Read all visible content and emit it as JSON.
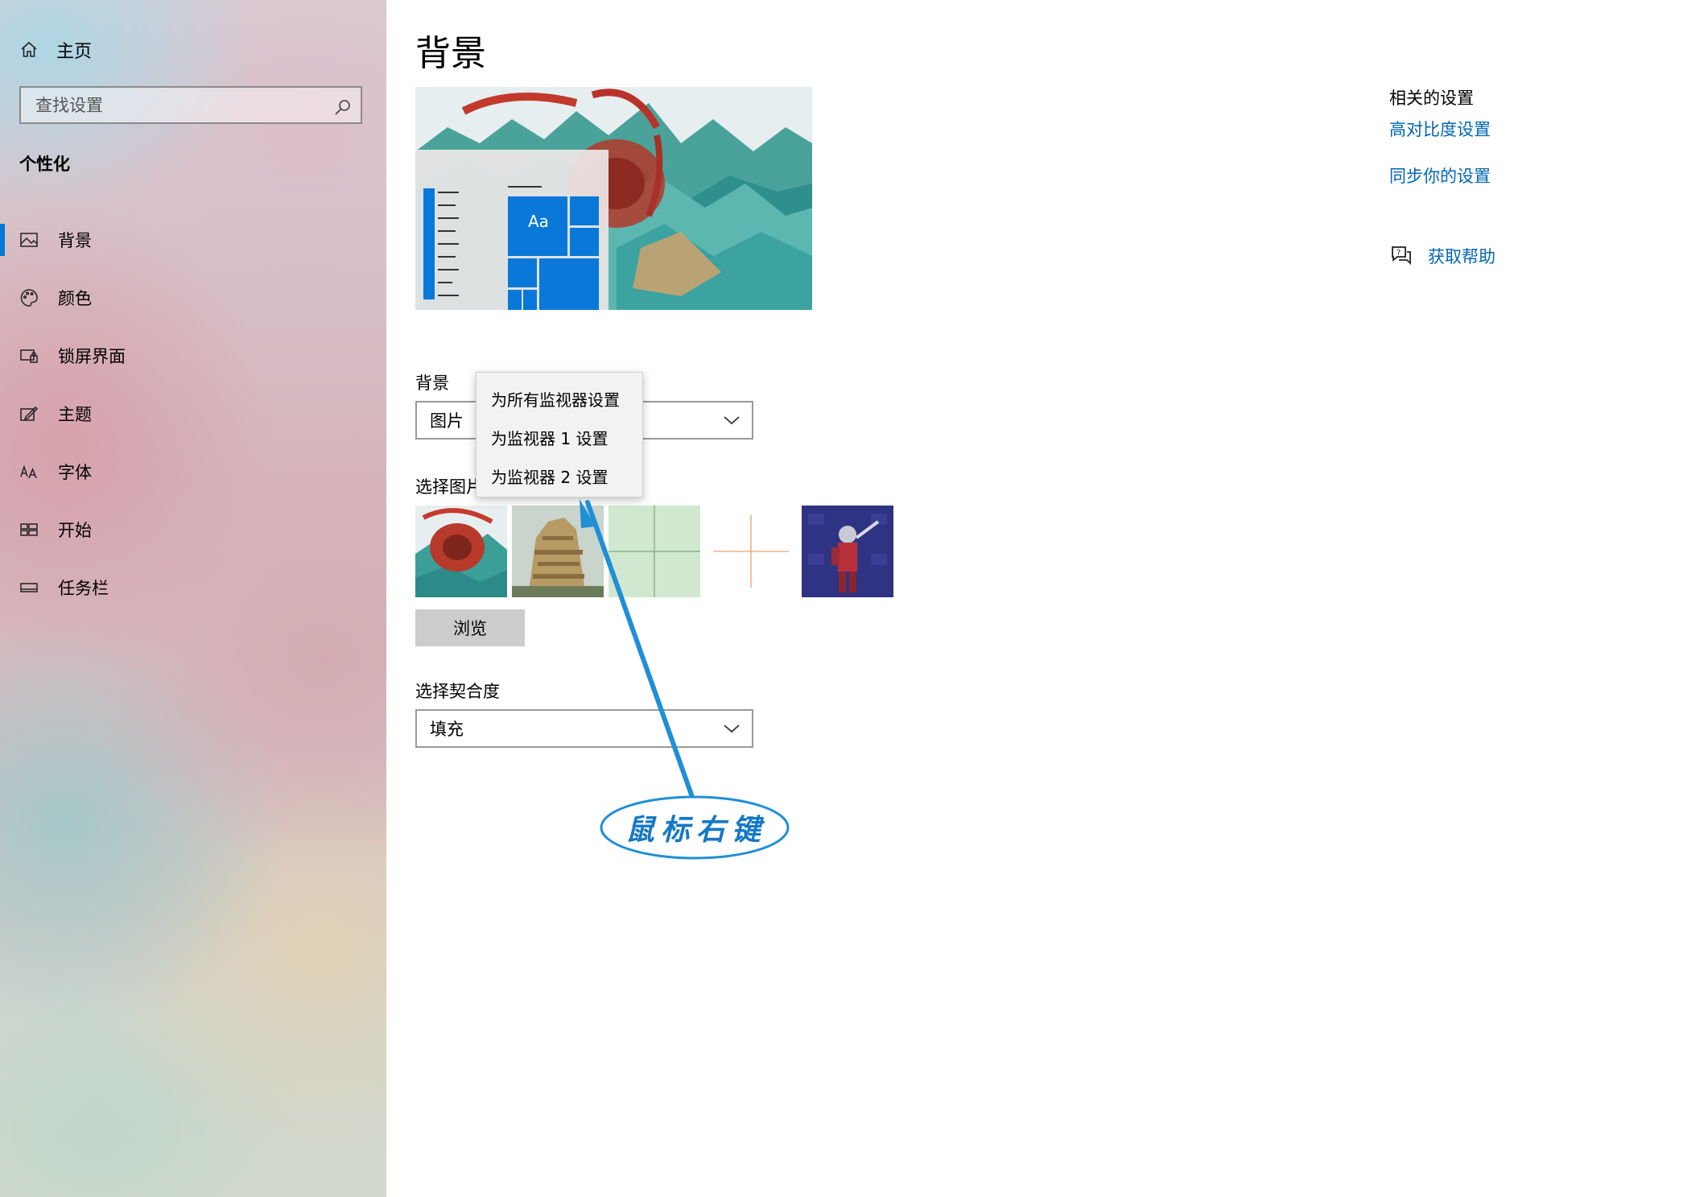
{
  "sidebar": {
    "home_label": "主页",
    "search_placeholder": "查找设置",
    "section_title": "个性化",
    "items": [
      {
        "label": "背景",
        "icon": "picture-icon"
      },
      {
        "label": "颜色",
        "icon": "palette-icon"
      },
      {
        "label": "锁屏界面",
        "icon": "lock-screen-icon"
      },
      {
        "label": "主题",
        "icon": "theme-icon"
      },
      {
        "label": "字体",
        "icon": "font-icon"
      },
      {
        "label": "开始",
        "icon": "start-icon"
      },
      {
        "label": "任务栏",
        "icon": "taskbar-icon"
      }
    ],
    "active_index": 0
  },
  "main": {
    "title": "背景",
    "preview": {
      "sample_text": "Aa"
    },
    "background_label": "背景",
    "background_value": "图片",
    "choose_picture_label": "选择图片",
    "browse_label": "浏览",
    "fit_label": "选择契合度",
    "fit_value": "填充"
  },
  "context_menu": {
    "items": [
      "为所有监视器设置",
      "为监视器 1 设置",
      "为监视器 2 设置"
    ]
  },
  "related": {
    "title": "相关的设置",
    "links": [
      "高对比度设置",
      "同步你的设置"
    ],
    "help_label": "获取帮助"
  },
  "annotation": {
    "text": "鼠标右键",
    "color": "#1578c5"
  },
  "colors": {
    "accent": "#0078d7",
    "link": "#0066b4"
  }
}
